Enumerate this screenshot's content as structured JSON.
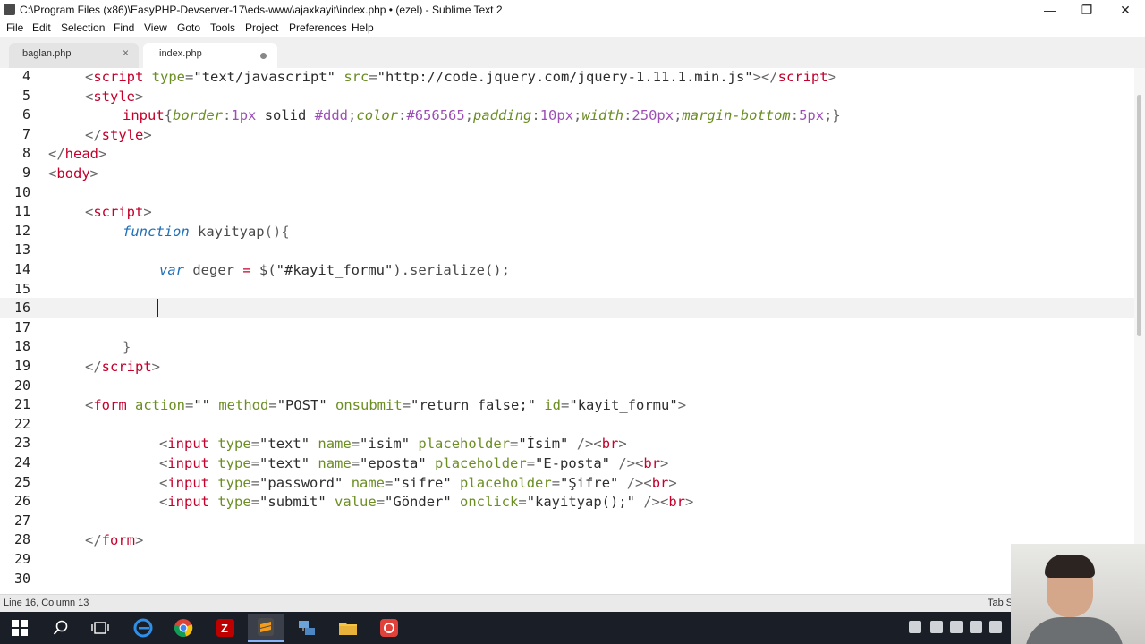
{
  "window": {
    "title": "C:\\Program Files (x86)\\EasyPHP-Devserver-17\\eds-www\\ajaxkayit\\index.php • (ezel) - Sublime Text 2",
    "minimize": "—",
    "restore": "❐",
    "close": "✕"
  },
  "menu": [
    "File",
    "Edit",
    "Selection",
    "Find",
    "View",
    "Goto",
    "Tools",
    "Project",
    "Preferences",
    "Help"
  ],
  "tabs": [
    {
      "label": "baglan.php",
      "active": false,
      "close": "×"
    },
    {
      "label": "index.php",
      "active": true,
      "modified": true
    }
  ],
  "gutter": [
    "4",
    "5",
    "6",
    "7",
    "8",
    "9",
    "10",
    "11",
    "12",
    "13",
    "14",
    "15",
    "16",
    "17",
    "18",
    "19",
    "20",
    "21",
    "22",
    "23",
    "24",
    "25",
    "26",
    "27",
    "28",
    "29",
    "30"
  ],
  "code": {
    "l4": [
      "<",
      "script",
      " type",
      "=",
      "\"text/javascript\"",
      " src",
      "=",
      "\"http://code.jquery.com/jquery-1.11.1.min.js\"",
      "></",
      "script",
      ">"
    ],
    "l5": [
      "<",
      "style",
      ">"
    ],
    "l6": [
      "input",
      "{",
      "border",
      ":",
      "1px",
      " solid ",
      "#ddd",
      ";",
      "color",
      ":",
      "#656565",
      ";",
      "padding",
      ":",
      "10px",
      ";",
      "width",
      ":",
      "250px",
      ";",
      "margin-bottom",
      ":",
      "5px",
      ";}"
    ],
    "l7": [
      "</",
      "style",
      ">"
    ],
    "l8": [
      "</",
      "head",
      ">"
    ],
    "l9": [
      "<",
      "body",
      ">"
    ],
    "l11": [
      "<",
      "script",
      ">"
    ],
    "l12": [
      "function",
      " kayityap",
      "(){"
    ],
    "l14": [
      "var",
      " deger ",
      "=",
      " $(",
      "\"#kayit_formu\"",
      ").serialize();"
    ],
    "l18": [
      "}"
    ],
    "l19": [
      "</",
      "script",
      ">"
    ],
    "l21": [
      "<",
      "form",
      " action",
      "=",
      "\"\"",
      " method",
      "=",
      "\"POST\"",
      " onsubmit",
      "=",
      "\"return false;\"",
      " id",
      "=",
      "\"kayit_formu\"",
      ">"
    ],
    "l23": [
      "<",
      "input",
      " type",
      "=",
      "\"text\"",
      " name",
      "=",
      "\"isim\"",
      " placeholder",
      "=",
      "\"İsim\"",
      " /><",
      "br",
      ">"
    ],
    "l24": [
      "<",
      "input",
      " type",
      "=",
      "\"text\"",
      " name",
      "=",
      "\"eposta\"",
      " placeholder",
      "=",
      "\"E-posta\"",
      " /><",
      "br",
      ">"
    ],
    "l25": [
      "<",
      "input",
      " type",
      "=",
      "\"password\"",
      " name",
      "=",
      "\"sifre\"",
      " placeholder",
      "=",
      "\"Şifre\"",
      " /><",
      "br",
      ">"
    ],
    "l26": [
      "<",
      "input",
      " type",
      "=",
      "\"submit\"",
      " value",
      "=",
      "\"Gönder\"",
      " onclick",
      "=",
      "\"kayityap();\"",
      " /><",
      "br",
      ">"
    ],
    "l28": [
      "</",
      "form",
      ">"
    ]
  },
  "status": {
    "position": "Line 16, Column 13",
    "tab": "Tab S"
  },
  "colors": {
    "tag": "#c4002b",
    "attr": "#6b8e23",
    "keyword": "#1f6fb8",
    "number": "#9c4fb5"
  },
  "taskbar": {
    "items": [
      "windows-start-icon",
      "search-icon",
      "task-view-icon",
      "edge-icon",
      "chrome-icon",
      "filezilla-icon",
      "sublime-icon",
      "network-app-icon",
      "file-explorer-icon",
      "recorder-icon"
    ]
  }
}
